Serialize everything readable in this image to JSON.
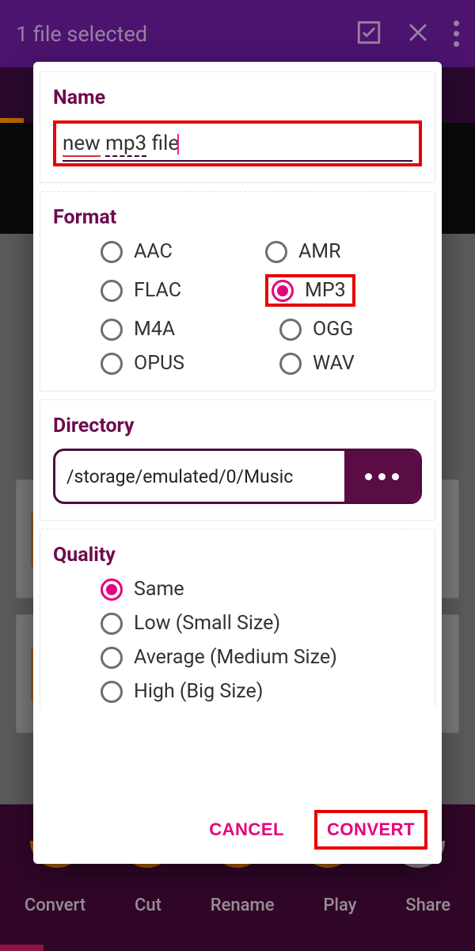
{
  "header": {
    "title": "1 file selected"
  },
  "bottom_nav": [
    "Convert",
    "Cut",
    "Rename",
    "Play",
    "Share"
  ],
  "dialog": {
    "name": {
      "title": "Name",
      "value": "new mp3 file"
    },
    "format": {
      "title": "Format",
      "options": [
        "AAC",
        "AMR",
        "FLAC",
        "MP3",
        "M4A",
        "OGG",
        "OPUS",
        "WAV"
      ],
      "selected": "MP3"
    },
    "directory": {
      "title": "Directory",
      "path": "/storage/emulated/0/Music"
    },
    "quality": {
      "title": "Quality",
      "options": [
        "Same",
        "Low (Small Size)",
        "Average (Medium Size)",
        "High (Big Size)"
      ],
      "selected": "Same"
    },
    "actions": {
      "cancel": "CANCEL",
      "convert": "CONVERT"
    }
  }
}
